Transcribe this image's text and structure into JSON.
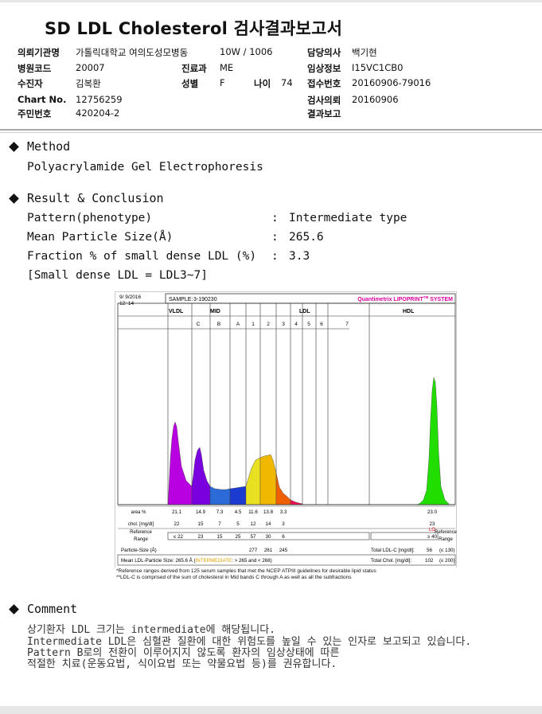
{
  "title": "SD LDL Cholesterol 검사결과보고서",
  "header": {
    "institution_label": "의뢰기관명",
    "institution": "가톨릭대학교 여의도성모병동",
    "ward": "10W / 1006",
    "doctor_label": "담당의사",
    "doctor": "백기현",
    "hospital_code_label": "병원코드",
    "hospital_code": "20007",
    "dept_label": "진료과",
    "dept": "ME",
    "clinical_label": "임상정보",
    "clinical": "I15VC1CB0",
    "patient_label": "수진자",
    "patient": "김복환",
    "sex_label": "성별",
    "sex": "F",
    "age_label": "나이",
    "age": "74",
    "receipt_label": "접수번호",
    "receipt": "20160906-79016",
    "chart_label": "Chart No.",
    "chart": "12756259",
    "request_label": "검사의뢰",
    "request": "20160906",
    "idnum_label": "주민번호",
    "idnum": "420204-2",
    "report_label": "결과보고",
    "report": ""
  },
  "method": {
    "heading": "Method",
    "text": "Polyacrylamide Gel Electrophoresis"
  },
  "result": {
    "heading": "Result & Conclusion",
    "rows": [
      {
        "label": "Pattern(phenotype)",
        "sep": ":",
        "value": "Intermediate type"
      },
      {
        "label": "Mean Particle Size(Å)",
        "sep": ":",
        "value": "265.6"
      },
      {
        "label": "Fraction % of small dense LDL (%)",
        "sep": ":",
        "value": "3.3"
      }
    ],
    "note": "[Small dense LDL = LDL3~7]"
  },
  "lipoprint": {
    "date": "9/ 9/2016",
    "time": "12: 14",
    "sample_label": "SAMPLE:",
    "sample": "3-190230",
    "brand": "Quantimetrix LIPOPRINT",
    "brand_tm": "TM",
    "brand_suffix": " SYSTEM",
    "groups": {
      "vldl": "VLDL",
      "mid": "MID",
      "ldl": "LDL",
      "hdl": "HDL"
    },
    "subbands": [
      "C",
      "B",
      "A",
      "1",
      "2",
      "3",
      "4",
      "5",
      "6",
      "7"
    ],
    "area_label": "area %",
    "chol_label": "chol. [mg/dl]",
    "ref_label_1": "Reference",
    "ref_label_2": "Range",
    "psize_label": "Particle-Size (Å)",
    "mean_label": "Mean LDL-Particle Size:",
    "mean_value": "265.6 Å",
    "mean_paren_open": "(",
    "mean_mid": "INTERMEDIATE",
    "mean_tail": ": > 265 and < 268)",
    "total_ldl_label": "Total LDL-C [mg/dl]:",
    "total_ldl": "56",
    "total_ldl_ref": "(≤ 130)",
    "total_chol_label": "Total Chol. [mg/dl]:",
    "total_chol": "102",
    "total_chol_ref": "(≤ 200)",
    "ref_left": "≤ 22",
    "ref_right": "≥ 40",
    "hdl_flag": "LO",
    "footnote_1": "*Reference ranges derived from 125 serum samples that met the NCEP ATPIII guidelines for desirable lipid status",
    "footnote_2": "**LDL-C is comprised of the sum of cholesterol in Mid bands C through A as well as all the subfractions",
    "colors": {
      "vldl": "#b800e0",
      "midC": "#7a00e0",
      "midB": "#2a6bd8",
      "midA": "#1a3ad0",
      "ldl1": "#e8e020",
      "ldl2": "#f0b800",
      "ldl3": "#f06000",
      "ldl4": "#ee1050",
      "hdl": "#22dd00",
      "brand": "#e000a0",
      "lo": "#e00000"
    }
  },
  "chart_data": {
    "type": "table",
    "columns": [
      "VLDL",
      "MID C",
      "MID B",
      "MID A",
      "LDL1",
      "LDL2",
      "LDL3",
      "LDL4",
      "LDL5",
      "LDL6",
      "LDL7",
      "HDL"
    ],
    "area_pct": [
      "21.1",
      "14.9",
      "7.3",
      "4.5",
      "11.6",
      "13.8",
      "3.3",
      "",
      "",
      "",
      "",
      "23.0"
    ],
    "chol_mg_dl": [
      "22",
      "15",
      "7",
      "5",
      "12",
      "14",
      "3",
      "",
      "",
      "",
      "",
      "23"
    ],
    "reference_range": [
      "≤ 22",
      "23",
      "15",
      "25",
      "57",
      "30",
      "6",
      "",
      "",
      "",
      "",
      "≥ 40"
    ],
    "particle_size": [
      "",
      "",
      "",
      "",
      "277",
      "261",
      "245",
      "",
      "",
      "",
      "",
      ""
    ]
  },
  "comment": {
    "heading": "Comment",
    "lines": [
      "상기환자 LDL 크기는 intermediate에 해당됩니다.",
      "Intermediate LDL은 심혈관 질환에 대한 위험도를 높일 수 있는 인자로 보고되고 있습니다.",
      "Pattern B로의 전환이 이루어지지 않도록 환자의 임상상태에 따른",
      "적절한 치료(운동요법, 식이요법 또는 약물요법 등)를 권유합니다."
    ]
  }
}
